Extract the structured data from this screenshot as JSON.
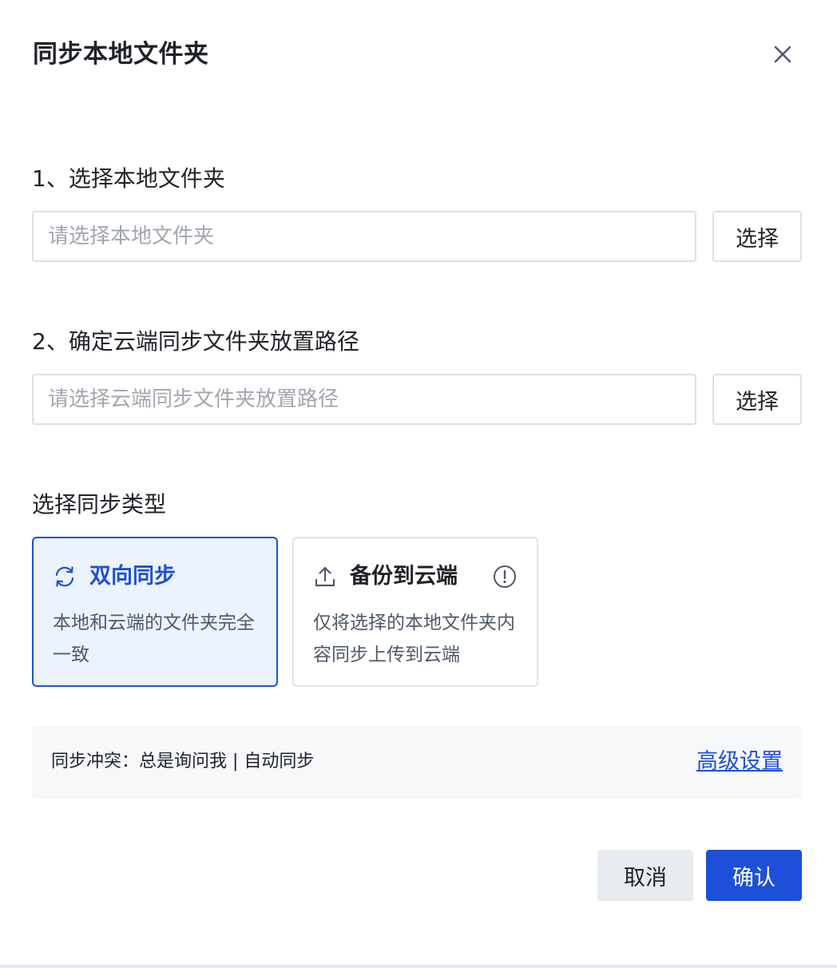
{
  "dialog": {
    "title": "同步本地文件夹",
    "close_icon": "close-icon"
  },
  "step1": {
    "label": "1、选择本地文件夹",
    "placeholder": "请选择本地文件夹",
    "value": "",
    "button_label": "选择"
  },
  "step2": {
    "label": "2、确定云端同步文件夹放置路径",
    "placeholder": "请选择云端同步文件夹放置路径",
    "value": "",
    "button_label": "选择"
  },
  "sync_type": {
    "label": "选择同步类型",
    "options": [
      {
        "icon": "sync-arrows-icon",
        "title": "双向同步",
        "description": "本地和云端的文件夹完全一致",
        "selected": true
      },
      {
        "icon": "upload-icon",
        "title": "备份到云端",
        "description": "仅将选择的本地文件夹内容同步上传到云端",
        "selected": false,
        "info_icon": "info-icon"
      }
    ]
  },
  "conflict": {
    "text": "同步冲突：总是询问我 | 自动同步",
    "advanced_link": "高级设置"
  },
  "footer": {
    "cancel_label": "取消",
    "confirm_label": "确认"
  },
  "colors": {
    "primary": "#1d4fd8",
    "selected_bg": "#edf3fe",
    "border": "#dcdfe4",
    "placeholder": "#a1a7b0",
    "cancel_bg": "#e8ebef",
    "conflict_bg": "#f6f8fa"
  }
}
